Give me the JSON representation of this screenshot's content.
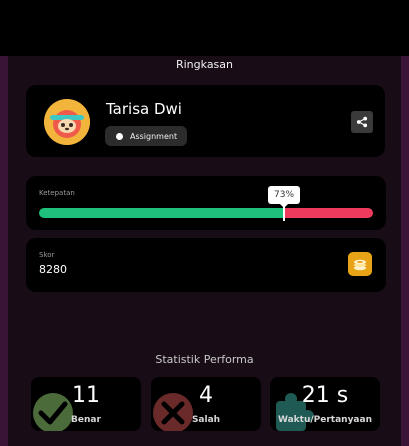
{
  "summary": {
    "title": "Ringkasan"
  },
  "profile": {
    "name": "Tarisa Dwi",
    "tag_label": "Assignment",
    "avatar_icon": "sloth-avatar-icon",
    "share_icon": "share-icon"
  },
  "accuracy": {
    "label": "Ketepatan",
    "percent_label": "73%",
    "percent": 73,
    "correct_color": "#1ec07c",
    "incorrect_color": "#ef3a5d"
  },
  "score": {
    "label": "Skor",
    "value": "8280",
    "icon": "coins-icon"
  },
  "performance": {
    "title": "Statistik Performa",
    "stats": [
      {
        "value": "11",
        "label": "Benar",
        "icon": "check-icon",
        "color": "#4b6b3a"
      },
      {
        "value": "4",
        "label": "Salah",
        "icon": "cross-icon",
        "color": "#6b2a2a"
      },
      {
        "value": "21 s",
        "label": "Waktu/Pertanyaan",
        "icon": "puzzle-icon",
        "color": "#1f5a55"
      }
    ]
  }
}
